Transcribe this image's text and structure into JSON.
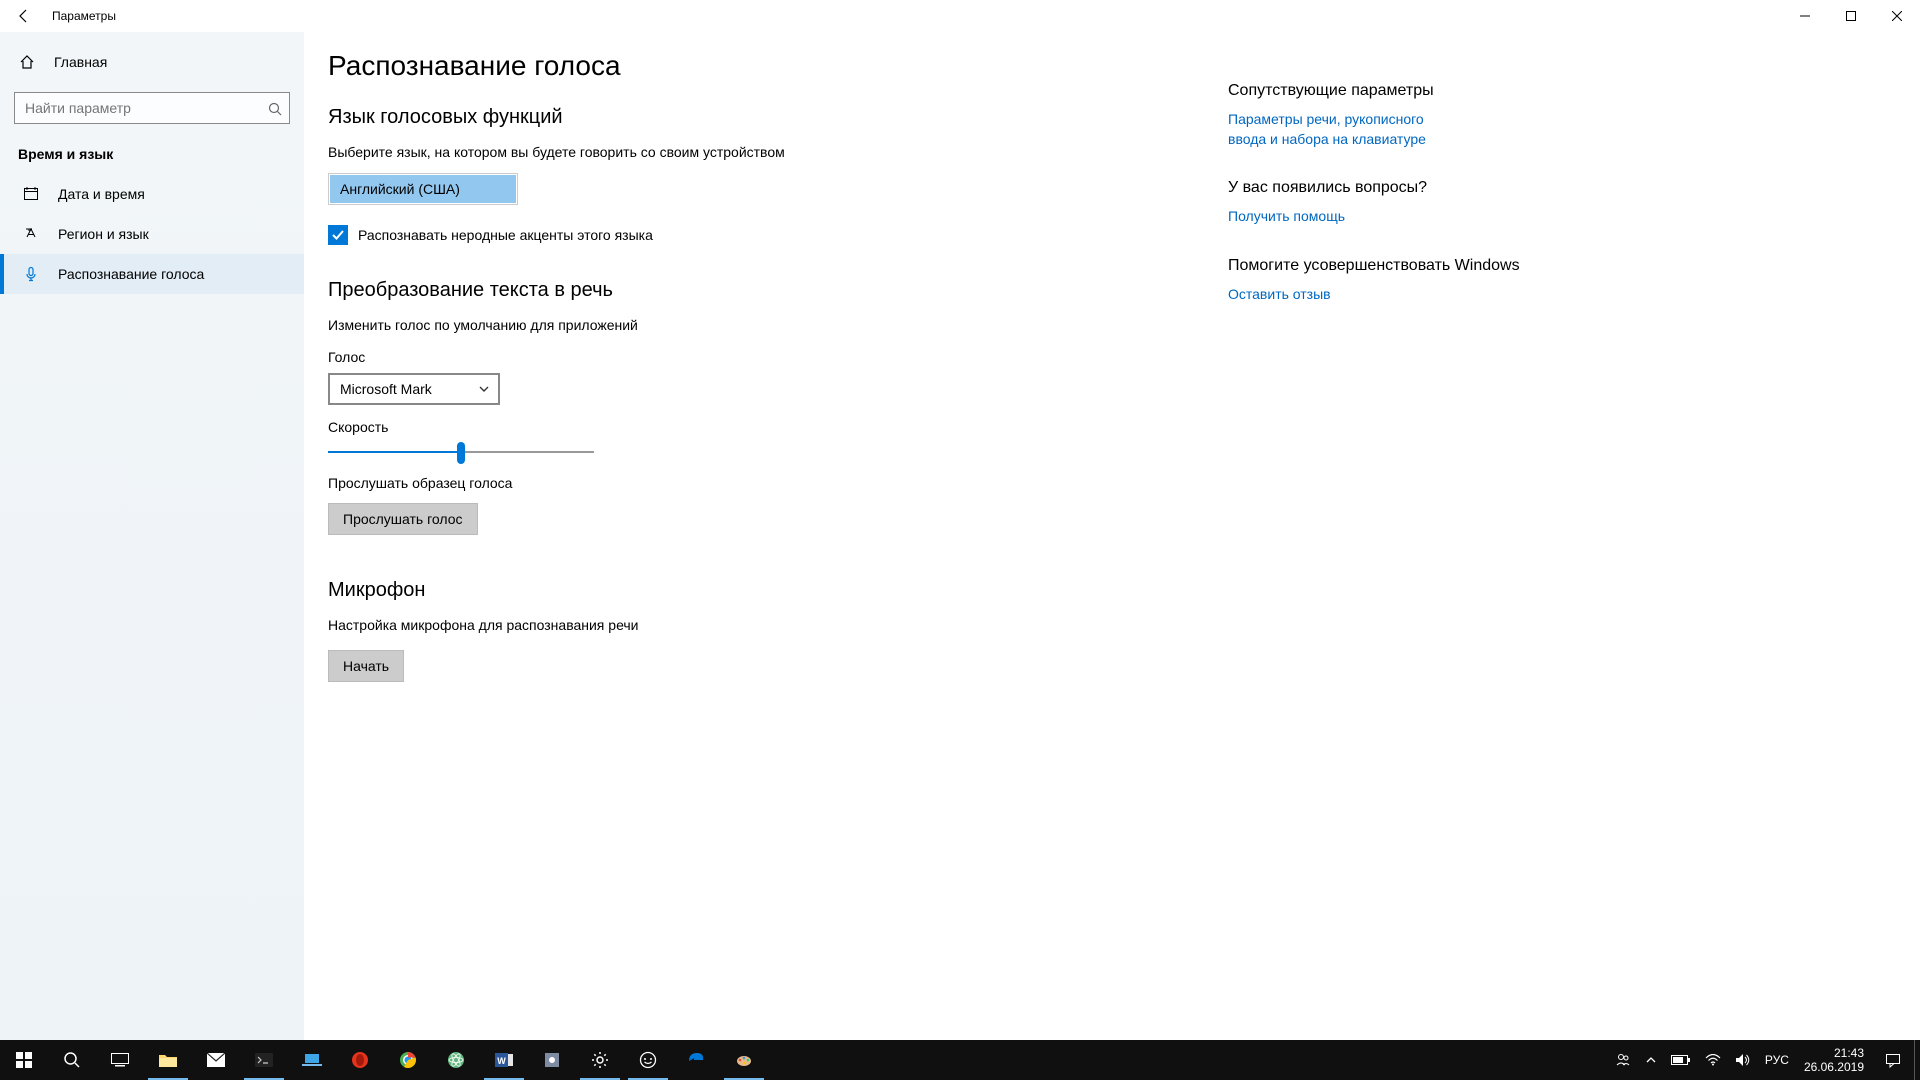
{
  "titlebar": {
    "title": "Параметры"
  },
  "sidebar": {
    "home": "Главная",
    "search_placeholder": "Найти параметр",
    "section": "Время и язык",
    "items": [
      {
        "label": "Дата и время"
      },
      {
        "label": "Регион и язык"
      },
      {
        "label": "Распознавание голоса"
      }
    ]
  },
  "page": {
    "title": "Распознавание голоса",
    "lang_section": "Язык голосовых функций",
    "lang_desc": "Выберите язык, на котором вы будете говорить со своим устройством",
    "lang_value": "Английский (США)",
    "accent_check": "Распознавать неродные акценты этого языка",
    "tts_section": "Преобразование текста в речь",
    "tts_desc": "Изменить голос по умолчанию для приложений",
    "voice_label": "Голос",
    "voice_value": "Microsoft Mark",
    "speed_label": "Скорость",
    "speed_percent": 50,
    "sample_label": "Прослушать образец голоса",
    "sample_btn": "Прослушать голос",
    "mic_section": "Микрофон",
    "mic_desc": "Настройка микрофона для распознавания речи",
    "mic_btn": "Начать"
  },
  "aside": {
    "related": "Сопутствующие параметры",
    "related_link": "Параметры речи, рукописного ввода и набора на клавиатуре",
    "questions": "У вас появились вопросы?",
    "help_link": "Получить помощь",
    "improve": "Помогите усовершенствовать Windows",
    "feedback_link": "Оставить отзыв"
  },
  "taskbar": {
    "lang": "РУС",
    "time": "21:43",
    "date": "26.06.2019"
  }
}
